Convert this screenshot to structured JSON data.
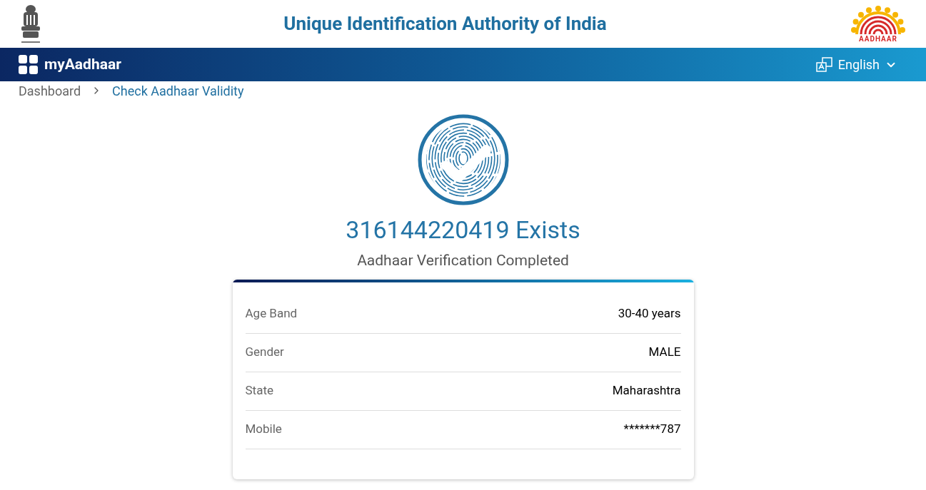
{
  "header": {
    "title": "Unique Identification Authority of India",
    "logo_text": "AADHAAR"
  },
  "navbar": {
    "brand": "myAadhaar",
    "language": "English"
  },
  "breadcrumb": [
    {
      "label": "Dashboard",
      "current": false
    },
    {
      "label": "Check Aadhaar Validity",
      "current": true
    }
  ],
  "result": {
    "heading": "316144220419 Exists",
    "subtitle": "Aadhaar Verification Completed"
  },
  "details": [
    {
      "label": "Age Band",
      "value": "30-40 years"
    },
    {
      "label": "Gender",
      "value": "MALE"
    },
    {
      "label": "State",
      "value": "Maharashtra"
    },
    {
      "label": "Mobile",
      "value": "*******787"
    }
  ]
}
